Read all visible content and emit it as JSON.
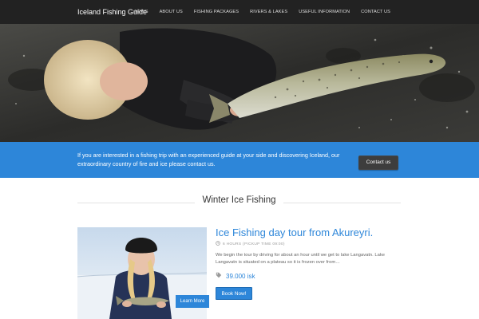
{
  "navbar": {
    "brand": "Iceland Fishing Guide",
    "items": [
      {
        "label": "NEWS"
      },
      {
        "label": "ABOUT US"
      },
      {
        "label": "FISHING PACKAGES"
      },
      {
        "label": "RIVERS & LAKES"
      },
      {
        "label": "USEFUL INFORMATION"
      },
      {
        "label": "CONTACT US"
      }
    ]
  },
  "cta": {
    "text": "If you are interested in a fishing trip with an experienced guide at your side and discovering Iceland, our extraordinary country of fire and ice please contact us.",
    "button_label": "Contact us"
  },
  "section": {
    "title": "Winter Ice Fishing"
  },
  "tour": {
    "title": "Ice Fishing day tour from Akureyri.",
    "duration": "6 HOURS (PICKUP TIME 09:00)",
    "description": "We begin the tour by driving for about an hour until we get to lake Langavatn. Lake Langavatn is situated on a plateau so it is frozen over from…",
    "price": "39.000 isk",
    "learn_more_label": "Learn More",
    "book_label": "Book Now!"
  },
  "colors": {
    "accent": "#2d86d9",
    "navbar": "#222222",
    "cta_button": "#3d3d3d"
  }
}
